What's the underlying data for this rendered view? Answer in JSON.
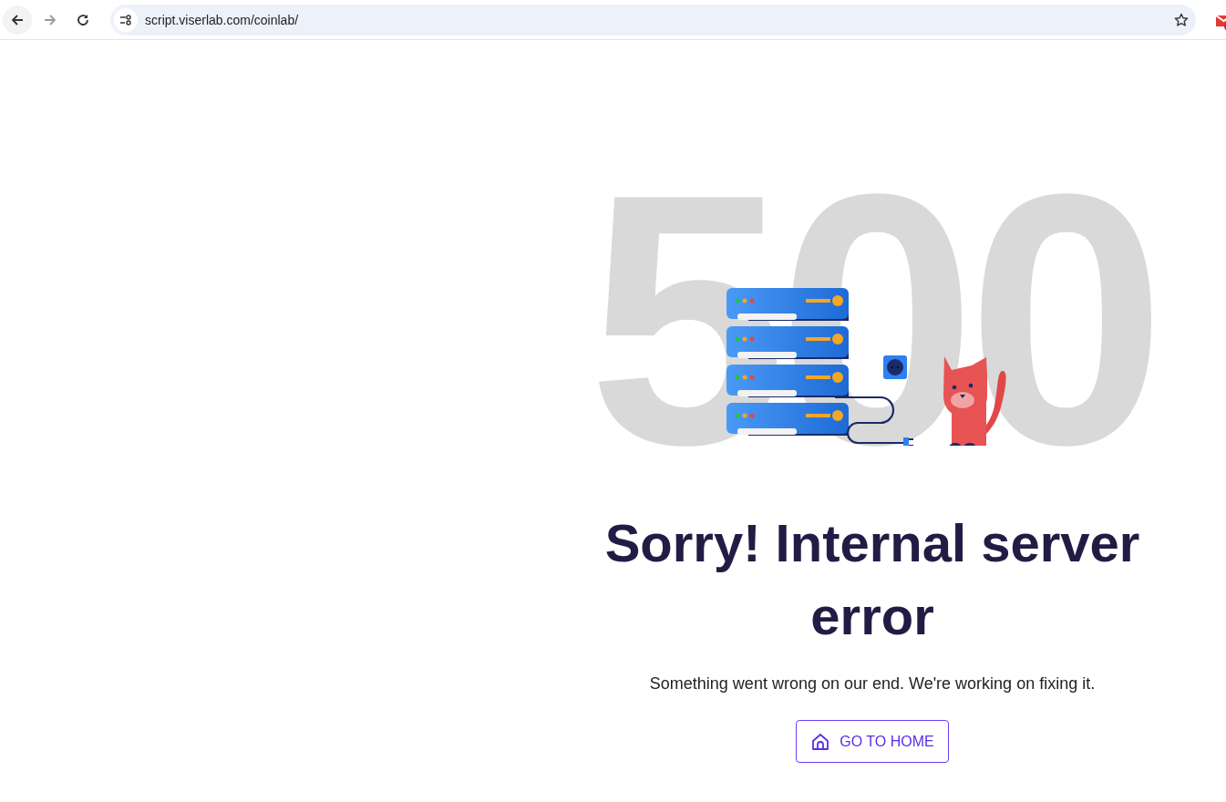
{
  "browser": {
    "url": "script.viserlab.com/coinlab/",
    "forward_disabled": true
  },
  "error": {
    "code": "500",
    "heading": "Sorry! Internal server error",
    "message": "Something went wrong on our end. We're working on fixing it.",
    "button": "GO TO HOME"
  }
}
